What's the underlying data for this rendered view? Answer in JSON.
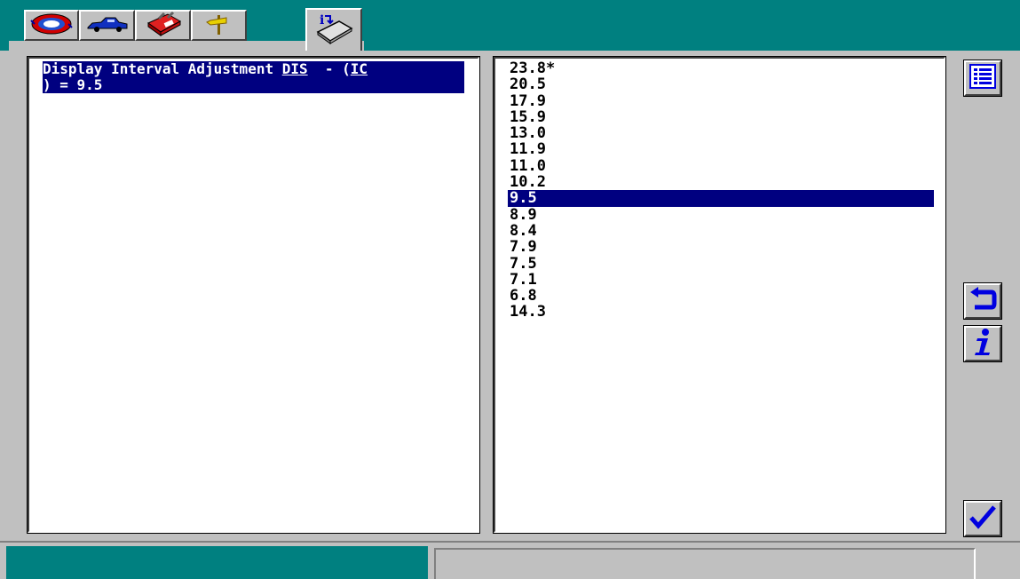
{
  "tabs": [
    {
      "name": "vehicle-id-icon",
      "active": false
    },
    {
      "name": "car-icon",
      "active": false
    },
    {
      "name": "toolbox-icon",
      "active": false
    },
    {
      "name": "signpost-icon",
      "active": false
    },
    {
      "name": "info-book-icon",
      "active": true
    }
  ],
  "description": {
    "line1_prefix": "Display Interval Adjustment ",
    "line1_link": "DIS",
    "line1_mid": "  - (",
    "line1_link2": "IC",
    "line2": ") = 9.5"
  },
  "values": [
    "23.8*",
    "20.5",
    "17.9",
    "15.9",
    "13.0",
    "11.9",
    "11.0",
    "10.2",
    "9.5",
    "8.9",
    "8.4",
    "7.9",
    "7.5",
    "7.1",
    "6.8",
    "14.3"
  ],
  "selected_value": "9.5",
  "side_buttons": [
    "list-icon",
    "back-icon",
    "info-icon",
    "checkmark-icon"
  ],
  "colors": {
    "teal": "#008080",
    "selection": "#000080",
    "panel_gray": "#c0c0c0",
    "icon_blue": "#0000e0"
  },
  "status_text": ""
}
